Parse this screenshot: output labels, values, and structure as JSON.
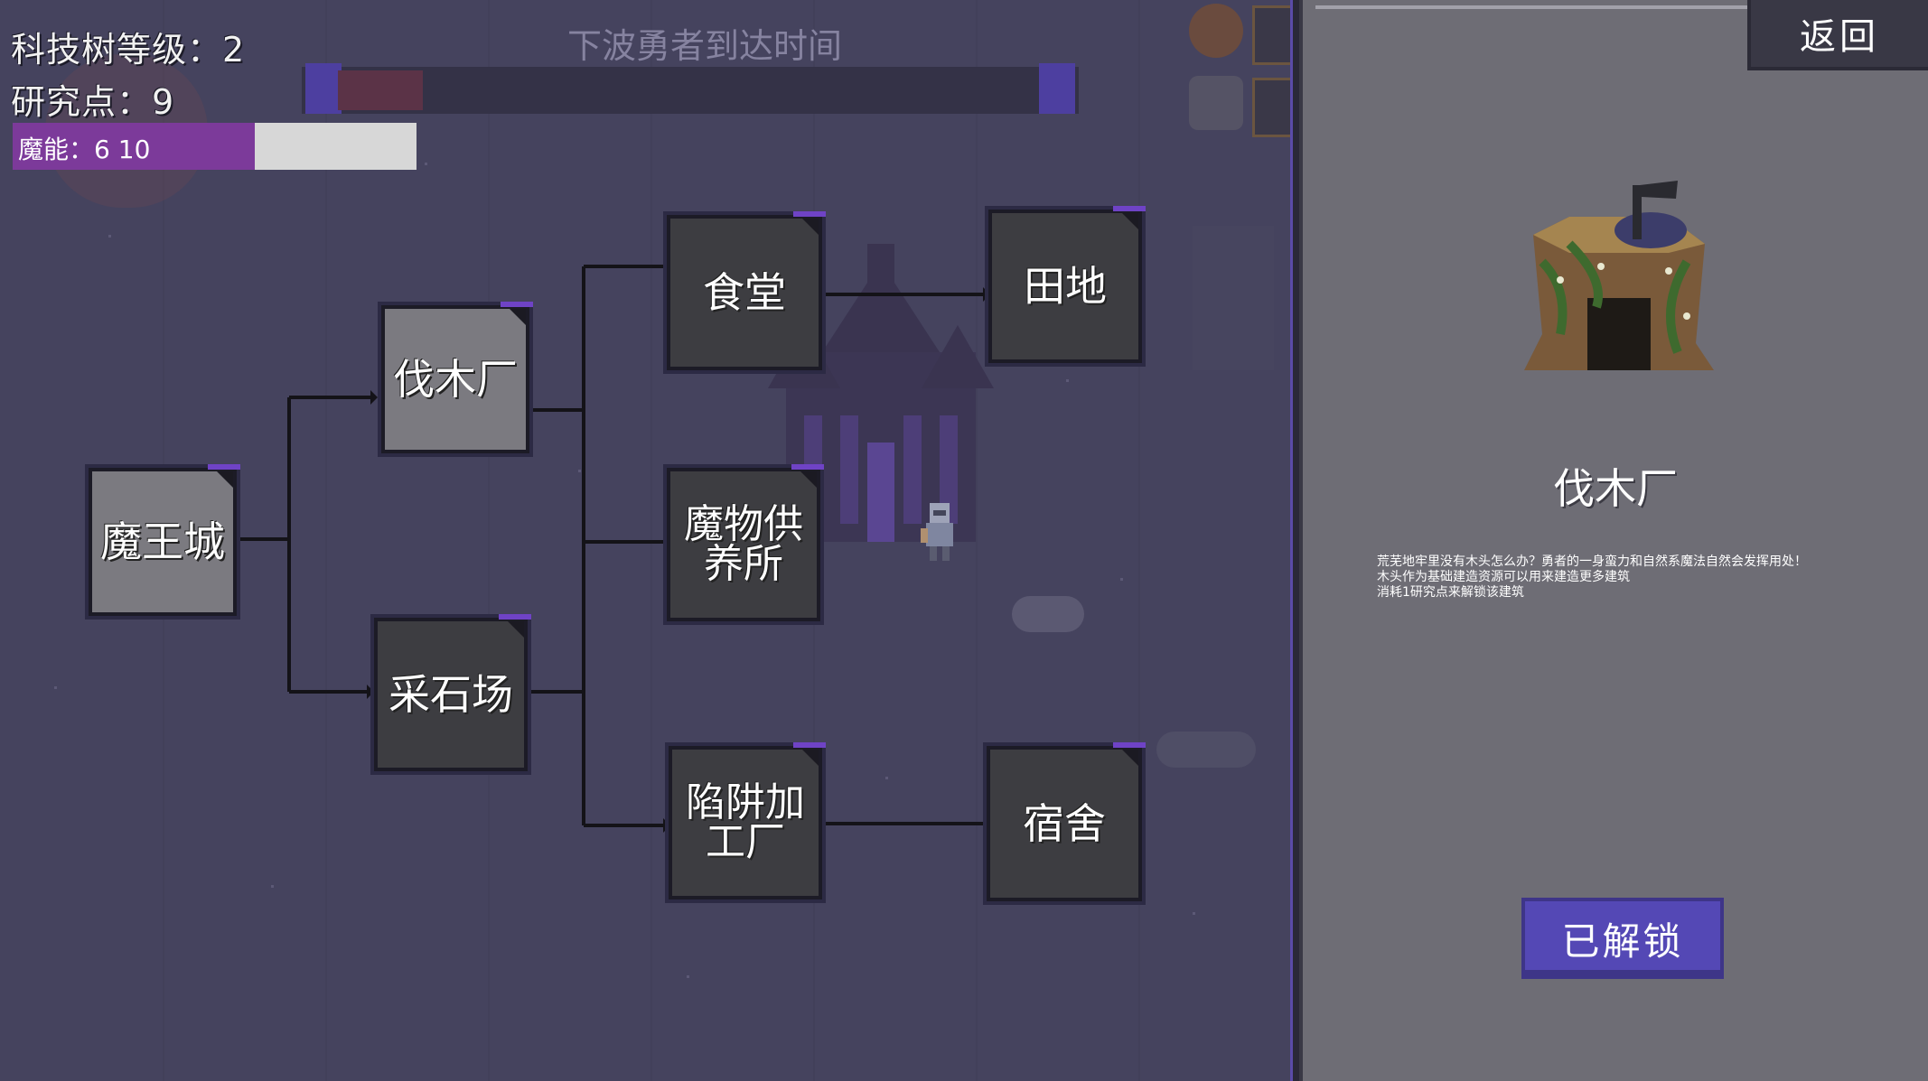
{
  "hud": {
    "tech_level_label": "科技树等级：",
    "tech_level_value": "2",
    "research_label": "研究点：",
    "research_value": "9",
    "mana_label": "魔能：",
    "mana_current": "6",
    "mana_max": "10",
    "mana_fraction": 0.6
  },
  "wave": {
    "title": "下波勇者到达时间",
    "progress": 0.12
  },
  "tree": {
    "nodes": {
      "demon_castle": "魔王城",
      "lumber_mill": "伐木厂",
      "quarry": "采石场",
      "canteen": "食堂",
      "monster_supply": "魔物供养所",
      "trap_workshop": "陷阱加工厂",
      "farmland": "田地",
      "dormitory": "宿舍"
    }
  },
  "panel": {
    "back_label": "返回",
    "building_name": "伐木厂",
    "description": [
      "荒芜地牢里没有木头怎么办？勇者的一身蛮力和自然系魔法自然会发挥用处！",
      "木头作为基础建造资源可以用来建造更多建筑",
      "消耗1研究点来解锁该建筑"
    ],
    "status_button": "已解锁"
  },
  "colors": {
    "accent": "#5448b5",
    "mana": "#7c3a9a",
    "panel": "#6e6d75",
    "scene": "#45435e"
  }
}
